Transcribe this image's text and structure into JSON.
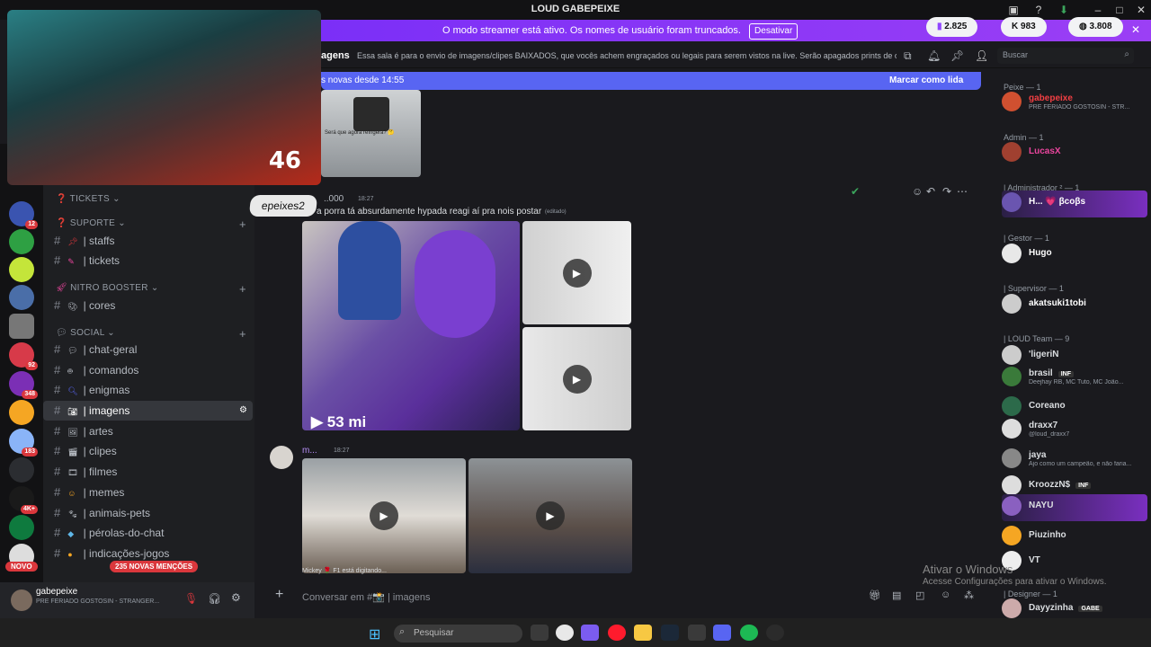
{
  "window": {
    "title": "LOUD GABEPEIXE"
  },
  "streamer": {
    "message": "O modo streamer está ativo. Os nomes de usuário foram truncados.",
    "disable_label": "Desativar"
  },
  "stats": {
    "twitch": "2.825",
    "kick": "983",
    "total": "3.808"
  },
  "webcam": {
    "counter": "46"
  },
  "stream_tag": "epeixes2",
  "categories": {
    "tickets": "TICKETS",
    "suporte": "SUPORTE",
    "nitro": "NITRO BOOSTER",
    "social": "SOCIAL"
  },
  "channels": {
    "staffs": "| staffs",
    "tickets": "| tickets",
    "cores": "| cores",
    "chat_geral": "| chat-geral",
    "comandos": "| comandos",
    "enigmas": "| enigmas",
    "imagens": "| imagens",
    "artes": "| artes",
    "clipes": "| clipes",
    "filmes": "| filmes",
    "memes": "| memes",
    "animais": "| animais-pets",
    "perolas": "| pérolas-do-chat",
    "indicacoes": "| indicações-jogos"
  },
  "servers": {
    "badge1": "12",
    "badge2": "92",
    "badge3": "348",
    "badge4": "183",
    "badge5": "4K+"
  },
  "mentions": {
    "new": "NOVO",
    "count": "235 NOVAS MENÇÕES"
  },
  "user": {
    "name": "gabepeixe",
    "status": "PRE FERIADO GOSTOSIN - STRANGER..."
  },
  "header": {
    "channel": "agens",
    "topic": "Essa sala é para o envio de imagens/clipes BAIXADOS, que vocês achem engraçados ou legais para serem vistos na live. Serão apagados prints de o...",
    "search": "Buscar"
  },
  "newbar": {
    "text": "s novas desde 14:55",
    "mark": "Marcar como lida"
  },
  "messages": {
    "m1_caption": "Será que agora refrigera? 🤔",
    "m2_author": "..000",
    "m2_time": "18:27",
    "m2_text": "a porra tá absurdamente hypada reagi aí pra nois postar",
    "m2_edited": "(editado)",
    "m2_overlay": "▶ 53 mi",
    "m3_author": "m...",
    "m3_time": "18:27",
    "typing": "Mickey 🌹 F1 está digitando..."
  },
  "composer": {
    "placeholder": "Conversar em #📸 | imagens"
  },
  "members": [
    {
      "head": "Peixe — 1",
      "name": "gabepeixe",
      "sub": "PRE FERIADO GOSTOSIN - STR...",
      "color": "#f23f43"
    },
    {
      "head": "Admin — 1",
      "name": "LucasX",
      "sub": "",
      "color": "#eb459e"
    },
    {
      "head": "| Administrador ² — 1",
      "name": "H... 💗 βcoβs",
      "sub": "",
      "color": "#ffffff"
    },
    {
      "head": "| Gestor — 1",
      "name": "Hugo",
      "sub": "",
      "color": "#ffffff"
    },
    {
      "head": "| Supervisor — 1",
      "name": "akatsuki1tobi",
      "sub": "",
      "color": "#ffffff"
    },
    {
      "head": "| LOUD Team — 9",
      "name": "'ligeriN",
      "sub": "",
      "color": "#dbdee1"
    },
    {
      "head": "",
      "name": "brasil",
      "sub": "Deejhay RB, MC Tuto, MC João...",
      "color": "#dbdee1"
    },
    {
      "head": "",
      "name": "Coreano",
      "sub": "",
      "color": "#dbdee1"
    },
    {
      "head": "",
      "name": "draxx7",
      "sub": "@loud_draxx7",
      "color": "#dbdee1"
    },
    {
      "head": "",
      "name": "jaya",
      "sub": "Ajo como um campeão, e não faria...",
      "color": "#dbdee1"
    },
    {
      "head": "",
      "name": "KroozzN$",
      "sub": "",
      "color": "#dbdee1"
    },
    {
      "head": "",
      "name": "NAYU",
      "sub": "",
      "color": "#dbdee1"
    },
    {
      "head": "",
      "name": "Piuzinho",
      "sub": "",
      "color": "#dbdee1"
    },
    {
      "head": "",
      "name": "VT",
      "sub": "",
      "color": "#dbdee1"
    },
    {
      "head": "| Designer — 1",
      "name": "Dayyzinha",
      "sub": "",
      "color": "#dbdee1"
    }
  ],
  "member_tags": {
    "inf": "INF",
    "gabe": "GABE"
  },
  "watermark": {
    "title": "Ativar o Windows",
    "sub": "Acesse Configurações para ativar o Windows."
  },
  "taskbar": {
    "search": "Pesquisar"
  }
}
